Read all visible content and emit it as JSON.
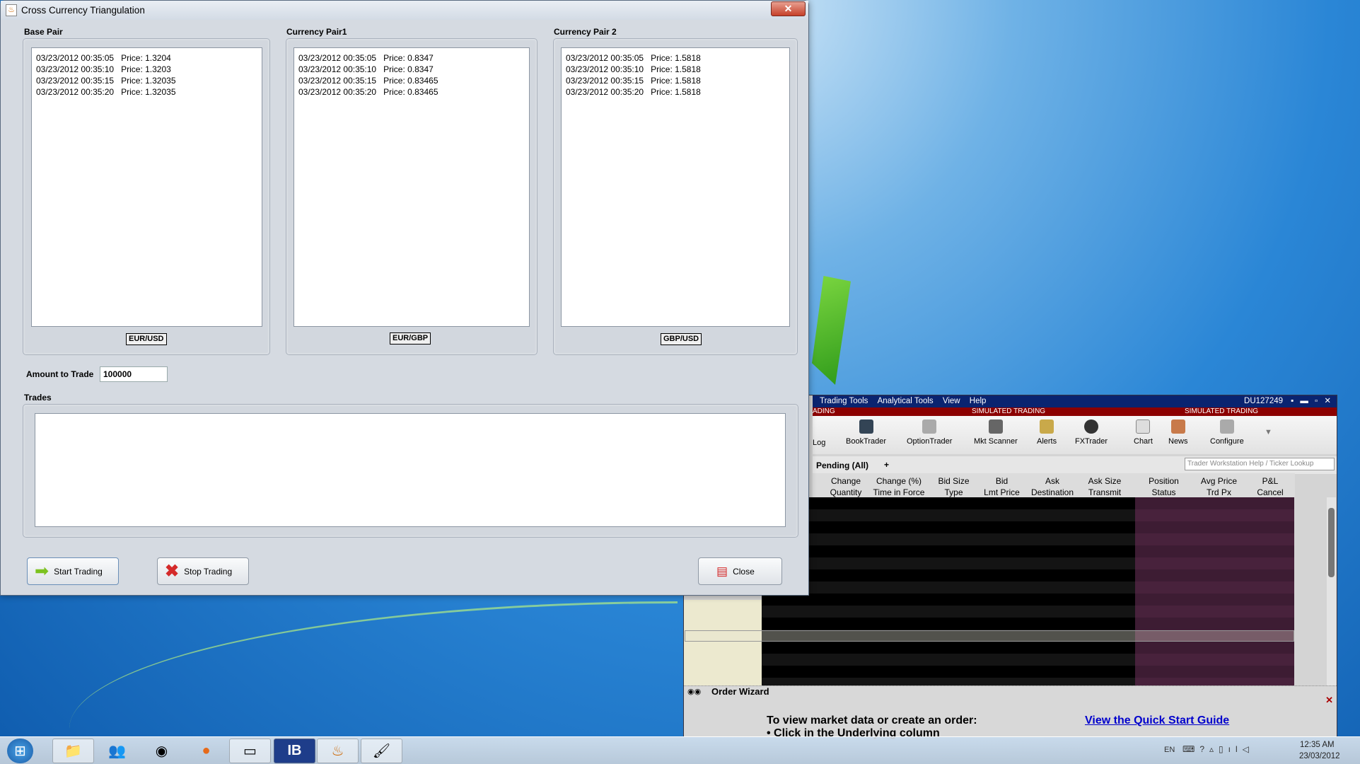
{
  "dialog": {
    "title": "Cross Currency Triangulation",
    "close_glyph": "✕",
    "panels": [
      {
        "label": "Base Pair",
        "pair": "EUR/USD",
        "rows": [
          "03/23/2012 00:35:05   Price: 1.3204",
          "03/23/2012 00:35:10   Price: 1.3203",
          "03/23/2012 00:35:15   Price: 1.32035",
          "03/23/2012 00:35:20   Price: 1.32035"
        ]
      },
      {
        "label": "Currency Pair1",
        "pair": "EUR/GBP",
        "rows": [
          "03/23/2012 00:35:05   Price: 0.8347",
          "03/23/2012 00:35:10   Price: 0.8347",
          "03/23/2012 00:35:15   Price: 0.83465",
          "03/23/2012 00:35:20   Price: 0.83465"
        ]
      },
      {
        "label": "Currency Pair 2",
        "pair": "GBP/USD",
        "rows": [
          "03/23/2012 00:35:05   Price: 1.5818",
          "03/23/2012 00:35:10   Price: 1.5818",
          "03/23/2012 00:35:15   Price: 1.5818",
          "03/23/2012 00:35:20   Price: 1.5818"
        ]
      }
    ],
    "amount_label": "Amount to Trade",
    "amount_value": "100000",
    "trades_label": "Trades",
    "start_label": "Start Trading",
    "stop_label": "Stop Trading",
    "close_label": "Close"
  },
  "tws": {
    "menu": [
      "Trading Tools",
      "Analytical Tools",
      "View",
      "Help"
    ],
    "account": "DU127249",
    "sim_left": "ADING",
    "sim": "SIMULATED TRADING",
    "tools": [
      "Log",
      "BookTrader",
      "OptionTrader",
      "Mkt Scanner",
      "Alerts",
      "FXTrader",
      "Chart",
      "News",
      "Configure"
    ],
    "tab": "Pending (All)",
    "tab_add": "+",
    "search_placeholder": "Trader Workstation Help / Ticker Lookup",
    "headers_top": [
      "Change",
      "Change (%)",
      "Bid Size",
      "Bid",
      "Ask",
      "Ask Size",
      "Position",
      "Avg Price",
      "P&L"
    ],
    "headers_bottom": [
      "Quantity",
      "Time in Force",
      "Type",
      "Lmt Price",
      "Destination",
      "Transmit",
      "Status",
      "Trd Px",
      "Cancel"
    ],
    "order_wizard": "Order Wizard",
    "ow_text": "To view market data or create an order:",
    "ow_bullet": "• Click in the Underlying column",
    "ow_link": "View the Quick Start Guide"
  },
  "taskbar": {
    "lang": "EN",
    "time": "12:35 AM",
    "date": "23/03/2012",
    "ib": "IB"
  },
  "colors": {
    "tws_menu": "#0a2470",
    "sim_bar": "#8b0000",
    "link": "#0000cc"
  }
}
